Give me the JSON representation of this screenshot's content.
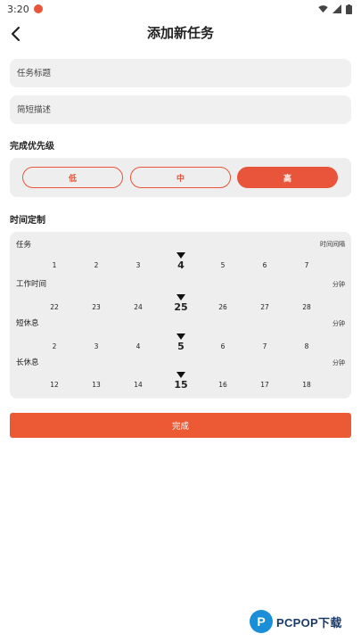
{
  "status_bar": {
    "time": "3:20"
  },
  "header": {
    "title": "添加新任务"
  },
  "form": {
    "title_placeholder": "任务标题",
    "desc_placeholder": "简短描述"
  },
  "priority": {
    "label": "完成优先级",
    "options": [
      "低",
      "中",
      "高"
    ],
    "selected": "高"
  },
  "timing": {
    "label": "时间定制",
    "header_left": "任务",
    "header_right": "时间间隔",
    "rows": [
      {
        "label": "",
        "unit": "",
        "values": [
          "1",
          "2",
          "3",
          "4",
          "5",
          "6",
          "7"
        ],
        "selected": "4"
      },
      {
        "label": "工作时间",
        "unit": "分钟",
        "values": [
          "22",
          "23",
          "24",
          "25",
          "26",
          "27",
          "28"
        ],
        "selected": "25"
      },
      {
        "label": "短休息",
        "unit": "分钟",
        "values": [
          "2",
          "3",
          "4",
          "5",
          "6",
          "7",
          "8"
        ],
        "selected": "5"
      },
      {
        "label": "长休息",
        "unit": "分钟",
        "values": [
          "12",
          "13",
          "14",
          "15",
          "16",
          "17",
          "18"
        ],
        "selected": "15"
      }
    ]
  },
  "actions": {
    "done": "完成"
  },
  "watermark": {
    "logo_letter": "P",
    "text": "PCPOP下载"
  },
  "colors": {
    "accent": "#e8553a",
    "panel": "#eeeeee",
    "input": "#f0f0f0"
  }
}
